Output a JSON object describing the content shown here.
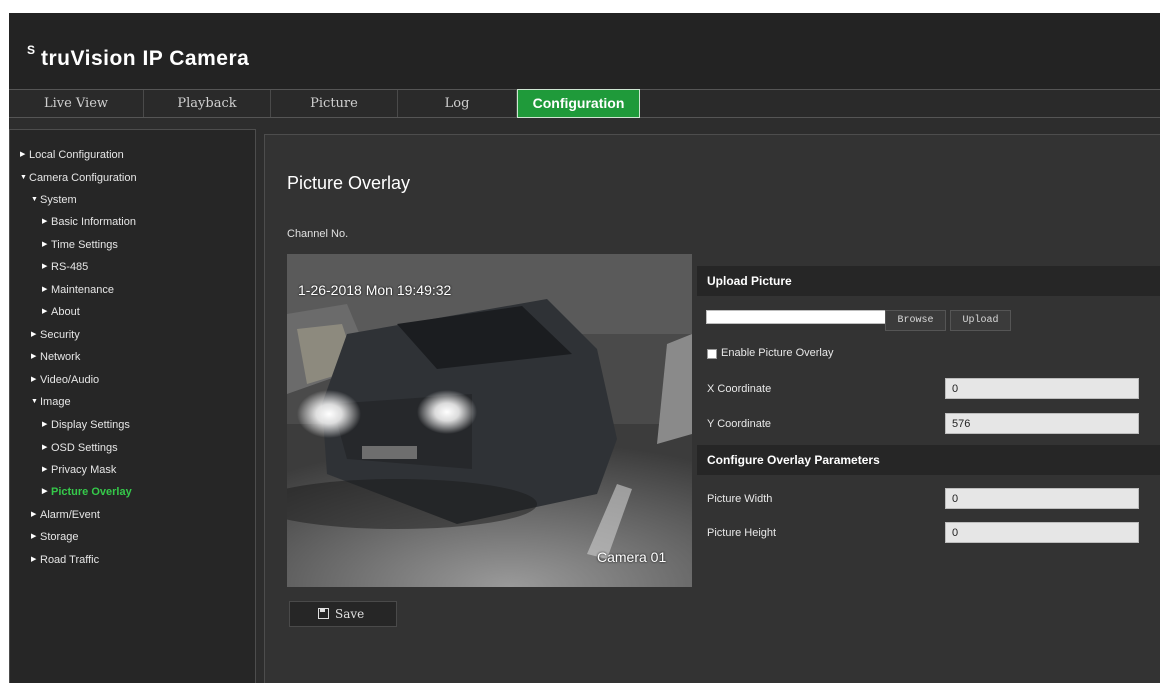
{
  "app": {
    "brand_mark": "S",
    "brand_name": "truVision  IP Camera"
  },
  "tabs": [
    {
      "label": "Live View",
      "active": false
    },
    {
      "label": "Playback",
      "active": false
    },
    {
      "label": "Picture",
      "active": false
    },
    {
      "label": "Log",
      "active": false
    },
    {
      "label": "Configuration",
      "active": true
    }
  ],
  "sidebar": {
    "items": [
      {
        "label": "Local Configuration",
        "expanded": false
      },
      {
        "label": "Camera Configuration",
        "expanded": true
      },
      {
        "label": "System",
        "expanded": true
      },
      {
        "label": "Basic Information",
        "expanded": false
      },
      {
        "label": "Time Settings",
        "expanded": false
      },
      {
        "label": "RS-485",
        "expanded": false
      },
      {
        "label": "Maintenance",
        "expanded": false
      },
      {
        "label": "About",
        "expanded": false
      },
      {
        "label": "Security",
        "expanded": false
      },
      {
        "label": "Network",
        "expanded": false
      },
      {
        "label": "Video/Audio",
        "expanded": false
      },
      {
        "label": "Image",
        "expanded": true
      },
      {
        "label": "Display Settings",
        "expanded": false
      },
      {
        "label": "OSD Settings",
        "expanded": false
      },
      {
        "label": "Privacy Mask",
        "expanded": false
      },
      {
        "label": "Picture Overlay",
        "expanded": false,
        "selected": true
      },
      {
        "label": "Alarm/Event",
        "expanded": false
      },
      {
        "label": "Storage",
        "expanded": false
      },
      {
        "label": "Road Traffic",
        "expanded": false
      }
    ]
  },
  "main": {
    "title": "Picture Overlay",
    "channel_label": "Channel No.",
    "camera": {
      "osd_time": "1-26-2018  Mon  19:49:32",
      "osd_name": "Camera 01"
    },
    "upload": {
      "section_title": "Upload Picture",
      "file_path": "",
      "browse_label": "Browse",
      "upload_label": "Upload",
      "enable_label": "Enable Picture Overlay",
      "enable_checked": false,
      "x_label": "X Coordinate",
      "x_value": "0",
      "y_label": "Y Coordinate",
      "y_value": "576"
    },
    "params": {
      "section_title": "Configure Overlay Parameters",
      "width_label": "Picture Width",
      "width_value": "0",
      "height_label": "Picture Height",
      "height_value": "0"
    },
    "save_label": "Save"
  },
  "colors": {
    "accent_green": "#1f9a3a",
    "selected_text": "#35c94a"
  }
}
